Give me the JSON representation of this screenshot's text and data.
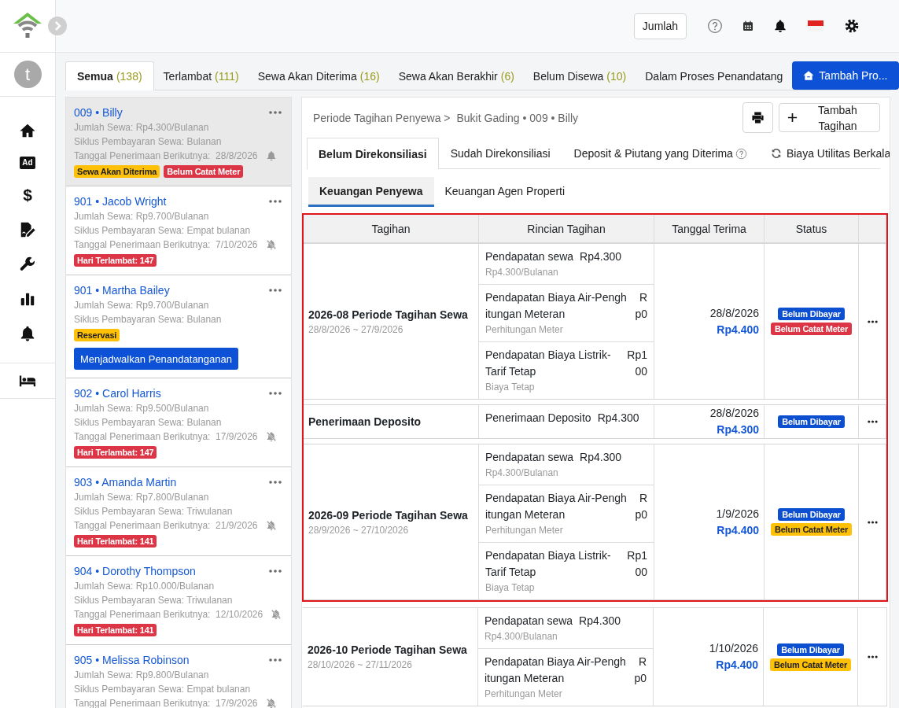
{
  "sidebar": {
    "avatar_letter": "t",
    "items": [
      {
        "kind": "home"
      },
      {
        "kind": "ad",
        "label": "Ad"
      },
      {
        "kind": "dollar",
        "label": "$"
      },
      {
        "kind": "contract"
      },
      {
        "kind": "wrench"
      },
      {
        "kind": "chart"
      },
      {
        "kind": "bell"
      }
    ],
    "bottom_items": [
      {
        "kind": "bed"
      }
    ]
  },
  "topbar": {
    "count_button": "Jumlah"
  },
  "status_tabs": [
    {
      "label": "Semua",
      "count": "(138)",
      "selected": true
    },
    {
      "label": "Terlambat",
      "count": "(111)",
      "selected": false
    },
    {
      "label": "Sewa Akan Diterima",
      "count": "(16)",
      "selected": false
    },
    {
      "label": "Sewa Akan Berakhir",
      "count": "(6)",
      "selected": false
    },
    {
      "label": "Belum Disewa",
      "count": "(10)",
      "selected": false
    },
    {
      "label": "Dalam Proses Penandatang",
      "selected": false
    }
  ],
  "add_property_button": "Tambah Pro...",
  "tenants": [
    {
      "title": "009 • Billy",
      "selected": true,
      "details": [
        "Jumlah Sewa: Rp4.300/Bulanan",
        "Siklus Pembayaran Sewa: Bulanan"
      ],
      "next_date": "Tanggal Penerimaan Berikutnya:  28/8/2026",
      "reminder": true,
      "tags": [
        {
          "text": "Sewa Akan Diterima",
          "color": "#ffc107"
        },
        {
          "text": "Belum Catat Meter",
          "color": "#dc3545"
        }
      ]
    },
    {
      "title": "901 • Jacob Wright",
      "selected": false,
      "details": [
        "Jumlah Sewa: Rp9.700/Bulanan",
        "Siklus Pembayaran Sewa: Empat bulanan"
      ],
      "next_date": "Tanggal Penerimaan Berikutnya:  7/10/2026",
      "reminder": false,
      "tags": [
        {
          "text": "Hari Terlambat: 147",
          "color": "#dc3545"
        }
      ]
    },
    {
      "title": "901 • Martha Bailey",
      "selected": false,
      "details": [
        "Jumlah Sewa: Rp9.700/Bulanan",
        "Siklus Pembayaran Sewa: Bulanan"
      ],
      "tags": [
        {
          "text": "Reservasi",
          "color": "#ffc107"
        }
      ],
      "action": "Menjadwalkan Penandatanganan"
    },
    {
      "title": "902 • Carol Harris",
      "selected": false,
      "details": [
        "Jumlah Sewa: Rp9.500/Bulanan",
        "Siklus Pembayaran Sewa: Bulanan"
      ],
      "next_date": "Tanggal Penerimaan Berikutnya:  17/9/2026",
      "reminder": false,
      "tags": [
        {
          "text": "Hari Terlambat: 147",
          "color": "#dc3545"
        }
      ]
    },
    {
      "title": "903 • Amanda Martin",
      "selected": false,
      "details": [
        "Jumlah Sewa: Rp7.800/Bulanan",
        "Siklus Pembayaran Sewa: Triwulanan"
      ],
      "next_date": "Tanggal Penerimaan Berikutnya:  21/9/2026",
      "reminder": false,
      "tags": [
        {
          "text": "Hari Terlambat: 141",
          "color": "#dc3545"
        }
      ]
    },
    {
      "title": "904 • Dorothy Thompson",
      "selected": false,
      "details": [
        "Jumlah Sewa: Rp10.000/Bulanan",
        "Siklus Pembayaran Sewa: Triwulanan"
      ],
      "next_date": "Tanggal Penerimaan Berikutnya:  12/10/2026",
      "reminder": false,
      "tags": [
        {
          "text": "Hari Terlambat: 141",
          "color": "#dc3545"
        }
      ]
    },
    {
      "title": "905 • Melissa Robinson",
      "selected": false,
      "details": [
        "Jumlah Sewa: Rp9.800/Bulanan",
        "Siklus Pembayaran Sewa: Empat bulanan"
      ],
      "next_date": "Tanggal Penerimaan Berikutnya:  17/9/2026",
      "reminder": false
    }
  ],
  "bill_panel": {
    "breadcrumb": [
      "Periode Tagihan Penyewa >",
      "Bukit Gading • 009 • Billy"
    ],
    "add_button": "Tambah Tagihan",
    "tabs": [
      {
        "label": "Belum Direkonsiliasi",
        "kind": "plain",
        "selected": true
      },
      {
        "label": "Sudah Direkonsiliasi",
        "kind": "plain",
        "selected": false
      },
      {
        "label": "Deposit & Piutang yang Diterima",
        "kind": "help",
        "selected": false
      },
      {
        "label": "Biaya Utilitas Berkala",
        "kind": "refresh",
        "selected": false
      }
    ],
    "subtabs": [
      {
        "label": "Keuangan Penyewa",
        "selected": true
      },
      {
        "label": "Keuangan Agen Properti",
        "selected": false
      }
    ],
    "table": {
      "columns": [
        "Tagihan",
        "Rincian Tagihan",
        "Tanggal Terima",
        "Status"
      ],
      "rows": [
        {
          "title": "2026-08 Periode Tagihan Sewa",
          "period": "28/8/2026 ~ 27/9/2026",
          "highlighted": true,
          "items": [
            {
              "label": "Pendapatan sewa",
              "amount": "Rp4.300",
              "note": "Rp4.300/Bulanan"
            },
            {
              "label": "Pendapatan Biaya Air-Penghitungan Meteran",
              "amount": "Rp0",
              "note": "Perhitungan Meter"
            },
            {
              "label": "Pendapatan Biaya Listrik-Tarif Tetap",
              "amount": "Rp100",
              "note": "Biaya Tetap"
            }
          ],
          "date": "28/8/2026",
          "amount": "Rp4.400",
          "statuses": [
            {
              "text": "Belum Dibayar",
              "color": "#0d4fd1"
            },
            {
              "text": "Belum Catat Meter",
              "color": "#dc3545"
            }
          ]
        },
        {
          "title": "Penerimaan Deposito",
          "highlighted": true,
          "items": [
            {
              "label": "Penerimaan Deposito",
              "amount": "Rp4.300"
            }
          ],
          "date": "28/8/2026",
          "amount": "Rp4.300",
          "statuses": [
            {
              "text": "Belum Dibayar",
              "color": "#0d4fd1"
            }
          ]
        },
        {
          "title": "2026-09 Periode Tagihan Sewa",
          "period": "28/9/2026 ~ 27/10/2026",
          "highlighted": true,
          "items": [
            {
              "label": "Pendapatan sewa",
              "amount": "Rp4.300",
              "note": "Rp4.300/Bulanan"
            },
            {
              "label": "Pendapatan Biaya Air-Penghitungan Meteran",
              "amount": "Rp0",
              "note": "Perhitungan Meter"
            },
            {
              "label": "Pendapatan Biaya Listrik-Tarif Tetap",
              "amount": "Rp100",
              "note": "Biaya Tetap"
            }
          ],
          "date": "1/9/2026",
          "amount": "Rp4.400",
          "statuses": [
            {
              "text": "Belum Dibayar",
              "color": "#0d4fd1"
            },
            {
              "text": "Belum Catat Meter",
              "color": "#ffc107"
            }
          ]
        },
        {
          "title": "2026-10 Periode Tagihan Sewa",
          "period": "28/10/2026 ~ 27/11/2026",
          "highlighted": false,
          "items": [
            {
              "label": "Pendapatan sewa",
              "amount": "Rp4.300",
              "note": "Rp4.300/Bulanan"
            },
            {
              "label": "Pendapatan Biaya Air-Penghitungan Meteran",
              "amount": "Rp0",
              "note": "Perhitungan Meter"
            }
          ],
          "date": "1/10/2026",
          "amount": "Rp4.400",
          "statuses": [
            {
              "text": "Belum Dibayar",
              "color": "#0d4fd1"
            },
            {
              "text": "Belum Catat Meter",
              "color": "#ffc107"
            }
          ]
        }
      ]
    }
  }
}
